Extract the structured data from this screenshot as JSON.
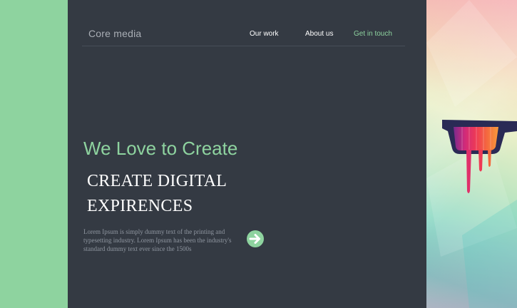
{
  "header": {
    "brand": "Core media",
    "nav": [
      {
        "label": "Our work"
      },
      {
        "label": "About us"
      },
      {
        "label": "Get in touch"
      }
    ]
  },
  "hero": {
    "tagline": "We Love to Create",
    "headline_line1": "CREATE DIGITAL",
    "headline_line2": "EXPIRENCES",
    "body": "Lorem Ipsum is simply dummy text of the printing and typesetting industry. Lorem Ipsum has been the industry's standard dummy text ever since the 1500s",
    "arrow_icon": "arrow-right-icon"
  },
  "colors": {
    "accent": "#8ed39f",
    "panel": "#343a43",
    "text_muted": "#8f96a0"
  }
}
